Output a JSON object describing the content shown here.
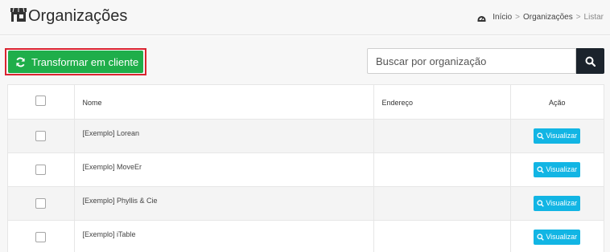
{
  "header": {
    "title": "Organizações",
    "breadcrumb": {
      "home": "Início",
      "section": "Organizações",
      "current": "Listar",
      "separator": ">"
    }
  },
  "toolbar": {
    "convert_label": "Transformar em cliente",
    "search_placeholder": "Buscar por organização"
  },
  "table": {
    "columns": [
      "",
      "Nome",
      "Endereço",
      "Ação"
    ],
    "view_label": "Visualizar",
    "rows": [
      {
        "name": "[Exemplo] Lorean",
        "address": ""
      },
      {
        "name": "[Exemplo] MoveEr",
        "address": ""
      },
      {
        "name": "[Exemplo] Phyllis & Cie",
        "address": ""
      },
      {
        "name": "[Exemplo] iTable",
        "address": ""
      }
    ]
  },
  "colors": {
    "primary_green": "#1fae4a",
    "highlight_red": "#d9232f",
    "view_blue": "#12b5e4",
    "search_dark": "#1b232c"
  },
  "icons": {
    "title": "store-icon",
    "breadcrumb": "dashboard-icon",
    "convert": "refresh-icon",
    "search": "search-icon",
    "view": "search-icon"
  }
}
